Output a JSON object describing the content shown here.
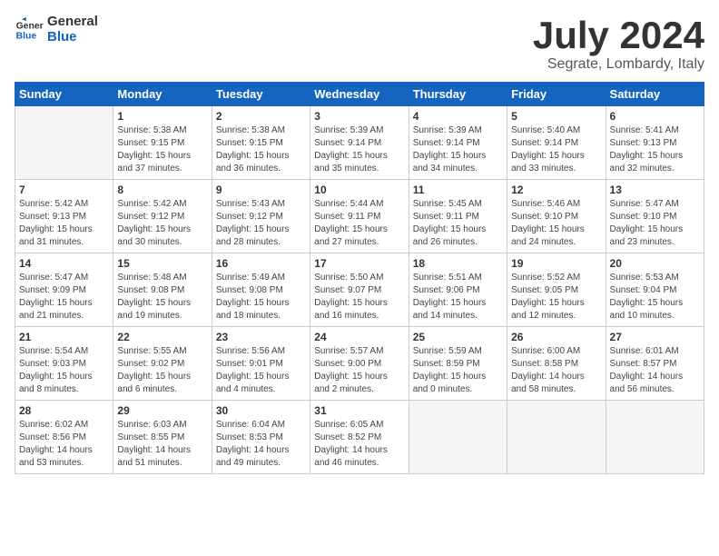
{
  "header": {
    "logo_line1": "General",
    "logo_line2": "Blue",
    "month": "July 2024",
    "location": "Segrate, Lombardy, Italy"
  },
  "days_of_week": [
    "Sunday",
    "Monday",
    "Tuesday",
    "Wednesday",
    "Thursday",
    "Friday",
    "Saturday"
  ],
  "weeks": [
    [
      {
        "day": "",
        "info": ""
      },
      {
        "day": "1",
        "info": "Sunrise: 5:38 AM\nSunset: 9:15 PM\nDaylight: 15 hours\nand 37 minutes."
      },
      {
        "day": "2",
        "info": "Sunrise: 5:38 AM\nSunset: 9:15 PM\nDaylight: 15 hours\nand 36 minutes."
      },
      {
        "day": "3",
        "info": "Sunrise: 5:39 AM\nSunset: 9:14 PM\nDaylight: 15 hours\nand 35 minutes."
      },
      {
        "day": "4",
        "info": "Sunrise: 5:39 AM\nSunset: 9:14 PM\nDaylight: 15 hours\nand 34 minutes."
      },
      {
        "day": "5",
        "info": "Sunrise: 5:40 AM\nSunset: 9:14 PM\nDaylight: 15 hours\nand 33 minutes."
      },
      {
        "day": "6",
        "info": "Sunrise: 5:41 AM\nSunset: 9:13 PM\nDaylight: 15 hours\nand 32 minutes."
      }
    ],
    [
      {
        "day": "7",
        "info": "Sunrise: 5:42 AM\nSunset: 9:13 PM\nDaylight: 15 hours\nand 31 minutes."
      },
      {
        "day": "8",
        "info": "Sunrise: 5:42 AM\nSunset: 9:12 PM\nDaylight: 15 hours\nand 30 minutes."
      },
      {
        "day": "9",
        "info": "Sunrise: 5:43 AM\nSunset: 9:12 PM\nDaylight: 15 hours\nand 28 minutes."
      },
      {
        "day": "10",
        "info": "Sunrise: 5:44 AM\nSunset: 9:11 PM\nDaylight: 15 hours\nand 27 minutes."
      },
      {
        "day": "11",
        "info": "Sunrise: 5:45 AM\nSunset: 9:11 PM\nDaylight: 15 hours\nand 26 minutes."
      },
      {
        "day": "12",
        "info": "Sunrise: 5:46 AM\nSunset: 9:10 PM\nDaylight: 15 hours\nand 24 minutes."
      },
      {
        "day": "13",
        "info": "Sunrise: 5:47 AM\nSunset: 9:10 PM\nDaylight: 15 hours\nand 23 minutes."
      }
    ],
    [
      {
        "day": "14",
        "info": "Sunrise: 5:47 AM\nSunset: 9:09 PM\nDaylight: 15 hours\nand 21 minutes."
      },
      {
        "day": "15",
        "info": "Sunrise: 5:48 AM\nSunset: 9:08 PM\nDaylight: 15 hours\nand 19 minutes."
      },
      {
        "day": "16",
        "info": "Sunrise: 5:49 AM\nSunset: 9:08 PM\nDaylight: 15 hours\nand 18 minutes."
      },
      {
        "day": "17",
        "info": "Sunrise: 5:50 AM\nSunset: 9:07 PM\nDaylight: 15 hours\nand 16 minutes."
      },
      {
        "day": "18",
        "info": "Sunrise: 5:51 AM\nSunset: 9:06 PM\nDaylight: 15 hours\nand 14 minutes."
      },
      {
        "day": "19",
        "info": "Sunrise: 5:52 AM\nSunset: 9:05 PM\nDaylight: 15 hours\nand 12 minutes."
      },
      {
        "day": "20",
        "info": "Sunrise: 5:53 AM\nSunset: 9:04 PM\nDaylight: 15 hours\nand 10 minutes."
      }
    ],
    [
      {
        "day": "21",
        "info": "Sunrise: 5:54 AM\nSunset: 9:03 PM\nDaylight: 15 hours\nand 8 minutes."
      },
      {
        "day": "22",
        "info": "Sunrise: 5:55 AM\nSunset: 9:02 PM\nDaylight: 15 hours\nand 6 minutes."
      },
      {
        "day": "23",
        "info": "Sunrise: 5:56 AM\nSunset: 9:01 PM\nDaylight: 15 hours\nand 4 minutes."
      },
      {
        "day": "24",
        "info": "Sunrise: 5:57 AM\nSunset: 9:00 PM\nDaylight: 15 hours\nand 2 minutes."
      },
      {
        "day": "25",
        "info": "Sunrise: 5:59 AM\nSunset: 8:59 PM\nDaylight: 15 hours\nand 0 minutes."
      },
      {
        "day": "26",
        "info": "Sunrise: 6:00 AM\nSunset: 8:58 PM\nDaylight: 14 hours\nand 58 minutes."
      },
      {
        "day": "27",
        "info": "Sunrise: 6:01 AM\nSunset: 8:57 PM\nDaylight: 14 hours\nand 56 minutes."
      }
    ],
    [
      {
        "day": "28",
        "info": "Sunrise: 6:02 AM\nSunset: 8:56 PM\nDaylight: 14 hours\nand 53 minutes."
      },
      {
        "day": "29",
        "info": "Sunrise: 6:03 AM\nSunset: 8:55 PM\nDaylight: 14 hours\nand 51 minutes."
      },
      {
        "day": "30",
        "info": "Sunrise: 6:04 AM\nSunset: 8:53 PM\nDaylight: 14 hours\nand 49 minutes."
      },
      {
        "day": "31",
        "info": "Sunrise: 6:05 AM\nSunset: 8:52 PM\nDaylight: 14 hours\nand 46 minutes."
      },
      {
        "day": "",
        "info": ""
      },
      {
        "day": "",
        "info": ""
      },
      {
        "day": "",
        "info": ""
      }
    ]
  ]
}
